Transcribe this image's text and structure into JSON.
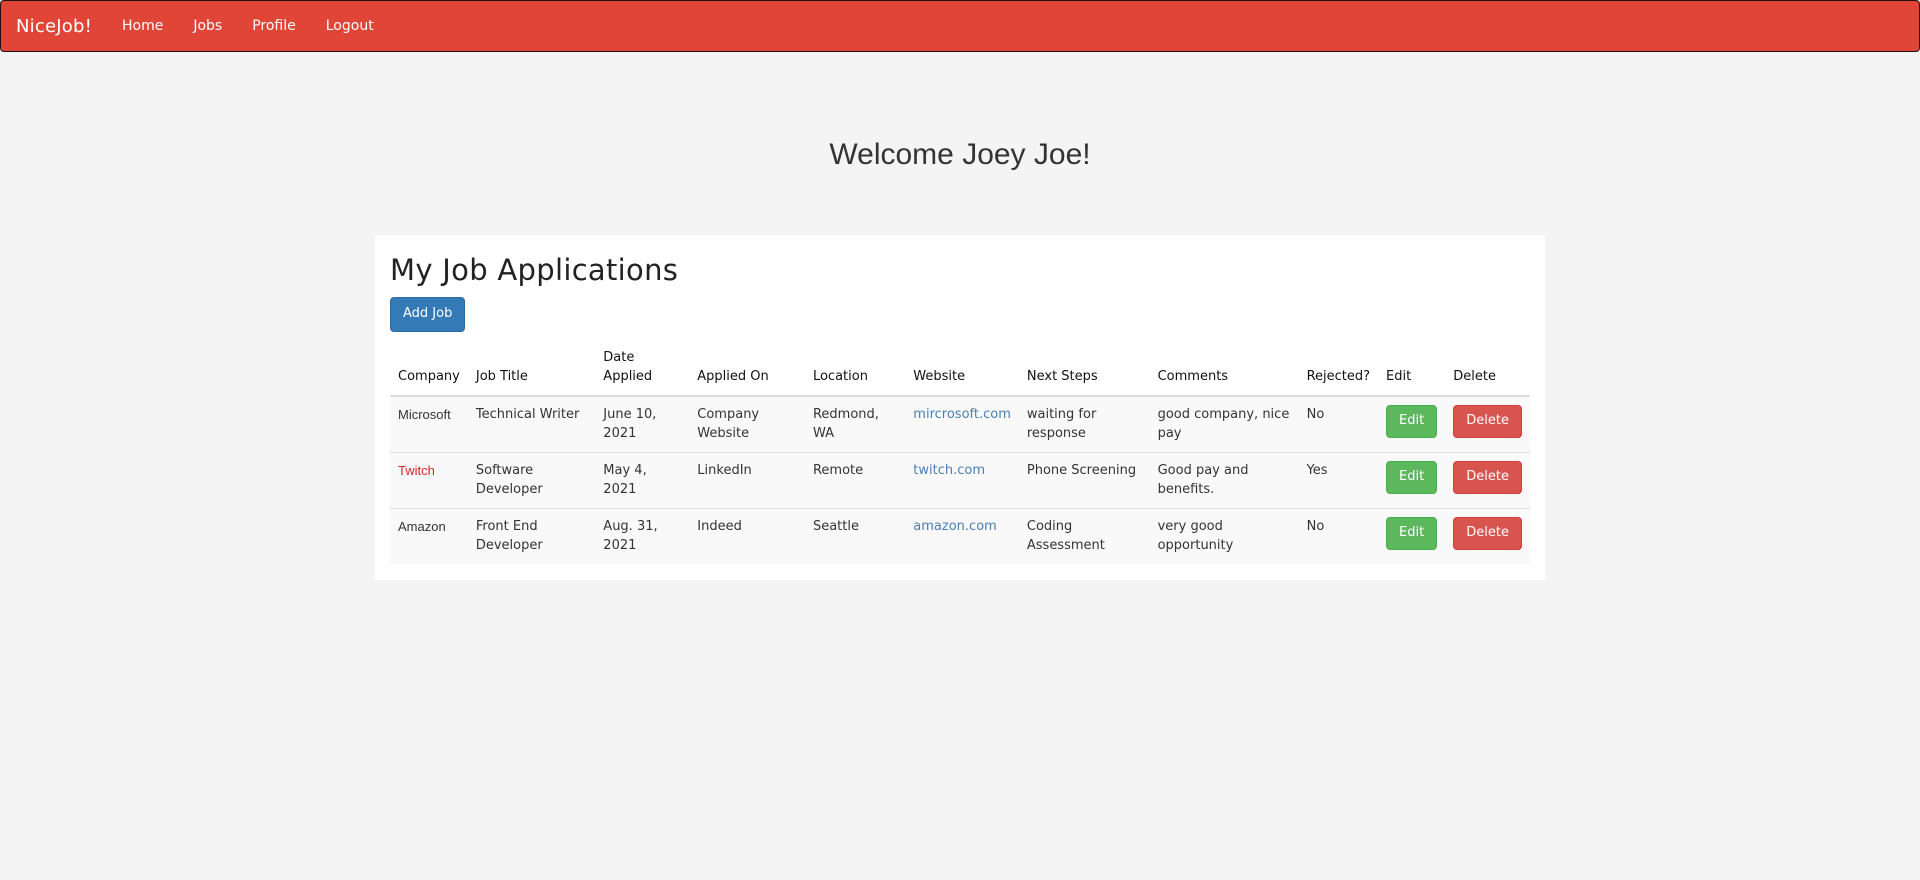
{
  "navbar": {
    "brand": "NiceJob!",
    "links": [
      "Home",
      "Jobs",
      "Profile",
      "Logout"
    ],
    "color": "#e04538"
  },
  "welcome": "Welcome Joey Joe!",
  "panel": {
    "title": "My Job Applications",
    "add_button": "Add Job"
  },
  "table": {
    "headers": {
      "company": "Company",
      "job_title": "Job Title",
      "date_applied_1": "Date",
      "date_applied_2": "Applied",
      "applied_on": "Applied On",
      "location": "Location",
      "website": "Website",
      "next_steps": "Next Steps",
      "comments": "Comments",
      "rejected": "Rejected?",
      "edit": "Edit",
      "delete": "Delete"
    },
    "rows": [
      {
        "company": "Microsoft",
        "job_title": "Technical Writer",
        "date_applied": "June 10, 2021",
        "applied_on": "Company Website",
        "location": "Redmond, WA",
        "website": "mircrosoft.com",
        "next_steps": "waiting for response",
        "comments": "good company, nice pay",
        "rejected": "No",
        "edit_label": "Edit",
        "delete_label": "Delete"
      },
      {
        "company": "Twitch",
        "job_title": "Software Developer",
        "date_applied": "May 4, 2021",
        "applied_on": "LinkedIn",
        "location": "Remote",
        "website": "twitch.com",
        "next_steps": "Phone Screening",
        "comments": "Good pay and benefits.",
        "rejected": "Yes",
        "edit_label": "Edit",
        "delete_label": "Delete"
      },
      {
        "company": "Amazon",
        "job_title": "Front End Developer",
        "date_applied": "Aug. 31, 2021",
        "applied_on": "Indeed",
        "location": "Seattle",
        "website": "amazon.com",
        "next_steps": "Coding Assessment",
        "comments": "very good opportunity",
        "rejected": "No",
        "edit_label": "Edit",
        "delete_label": "Delete"
      }
    ]
  }
}
